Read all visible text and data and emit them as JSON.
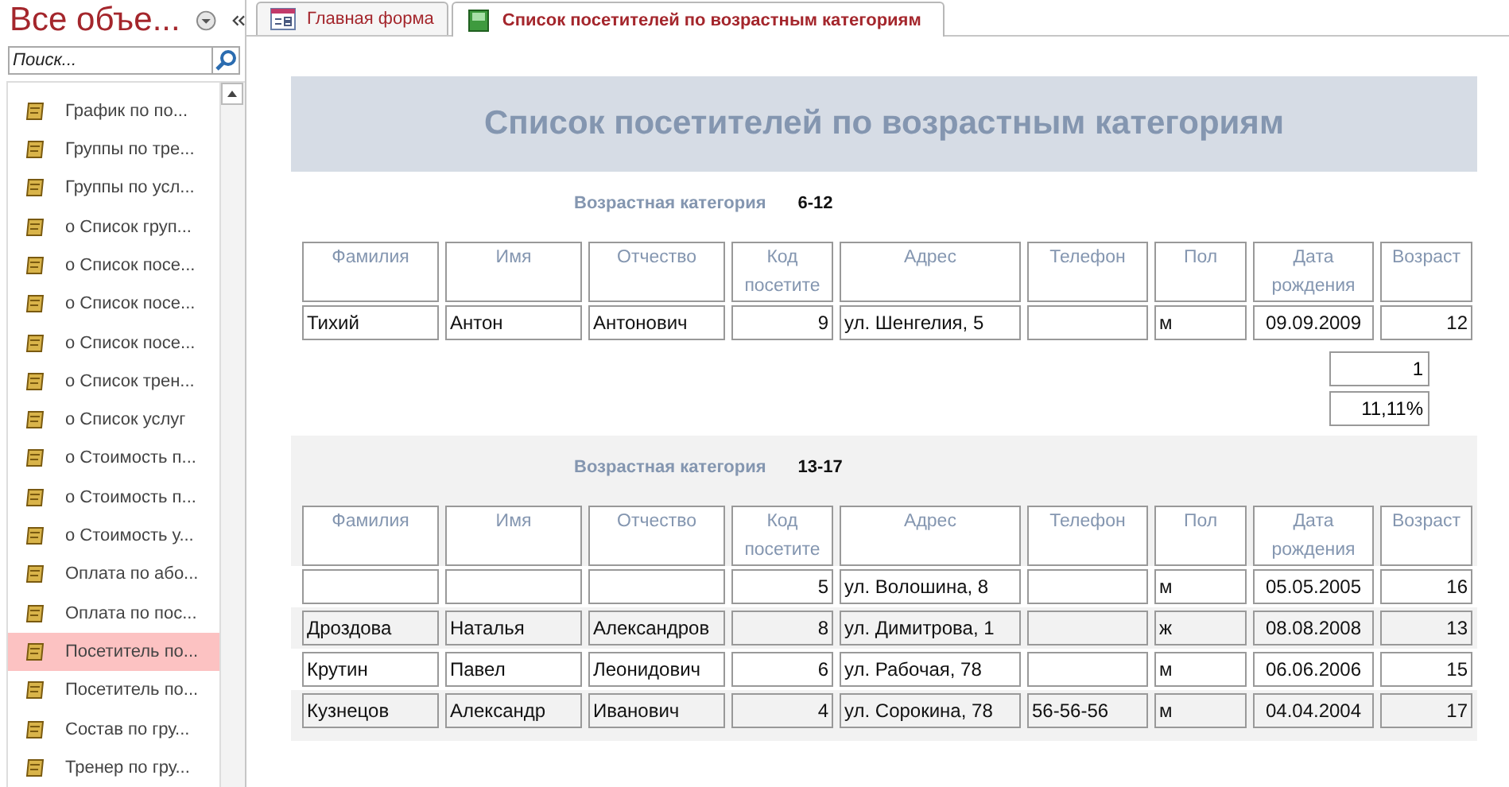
{
  "sidebar": {
    "title": "Все объе...",
    "search": {
      "placeholder": "Поиск..."
    },
    "items": [
      {
        "label": "График по по...",
        "selected": false
      },
      {
        "label": "Группы по тре...",
        "selected": false
      },
      {
        "label": "Группы по усл...",
        "selected": false
      },
      {
        "label": "о Список груп...",
        "selected": false
      },
      {
        "label": "о Список посе...",
        "selected": false
      },
      {
        "label": "о Список посе...",
        "selected": false
      },
      {
        "label": "о Список посе...",
        "selected": false
      },
      {
        "label": "о Список трен...",
        "selected": false
      },
      {
        "label": "о Список услуг",
        "selected": false
      },
      {
        "label": "о Стоимость п...",
        "selected": false
      },
      {
        "label": "о Стоимость п...",
        "selected": false
      },
      {
        "label": "о Стоимость у...",
        "selected": false
      },
      {
        "label": "Оплата по або...",
        "selected": false
      },
      {
        "label": "Оплата по пос...",
        "selected": false
      },
      {
        "label": "Посетитель по...",
        "selected": true
      },
      {
        "label": "Посетитель по...",
        "selected": false
      },
      {
        "label": "Состав по гру...",
        "selected": false
      },
      {
        "label": "Тренер по гру...",
        "selected": false
      }
    ]
  },
  "tabs": [
    {
      "label": "Главная форма",
      "kind": "form",
      "selected": false
    },
    {
      "label": "Список посетителей по возрастным категориям",
      "kind": "report",
      "selected": true
    }
  ],
  "report": {
    "title": "Список посетителей по возрастным категориям",
    "groups": [
      {
        "label": "Возрастная категория",
        "value": "6-12",
        "shaded": false,
        "columns": [
          "Фамилия",
          "Имя",
          "Отчество",
          "Код посетите",
          "Адрес",
          "Телефон",
          "Пол",
          "Дата рождения",
          "Возраст"
        ],
        "rows": [
          {
            "shaded": false,
            "cells": [
              "Тихий",
              "Антон",
              "Антонович",
              "9",
              "ул. Шенгелия, 5",
              null,
              "м",
              "09.09.2009",
              "12"
            ]
          }
        ],
        "totals": [
          "1",
          "11,11%"
        ]
      },
      {
        "label": "Возрастная категория",
        "value": "13-17",
        "shaded": true,
        "columns": [
          "Фамилия",
          "Имя",
          "Отчество",
          "Код посетите",
          "Адрес",
          "Телефон",
          "Пол",
          "Дата рождения",
          "Возраст"
        ],
        "rows": [
          {
            "shaded": false,
            "cells": [
              null,
              null,
              null,
              "5",
              "ул. Волошина, 8",
              null,
              "м",
              "05.05.2005",
              "16"
            ]
          },
          {
            "shaded": true,
            "cells": [
              "Дроздова",
              "Наталья",
              "Александров",
              "8",
              "ул. Димитрова, 1",
              null,
              "ж",
              "08.08.2008",
              "13"
            ]
          },
          {
            "shaded": false,
            "cells": [
              "Крутин",
              "Павел",
              "Леонидович",
              "6",
              "ул. Рабочая, 78",
              null,
              "м",
              "06.06.2006",
              "15"
            ]
          },
          {
            "shaded": true,
            "cells": [
              "Кузнецов",
              "Александр",
              "Иванович",
              "4",
              "ул. Сорокина, 78",
              "56-56-56",
              "м",
              "04.04.2004",
              "17"
            ]
          }
        ]
      }
    ]
  }
}
